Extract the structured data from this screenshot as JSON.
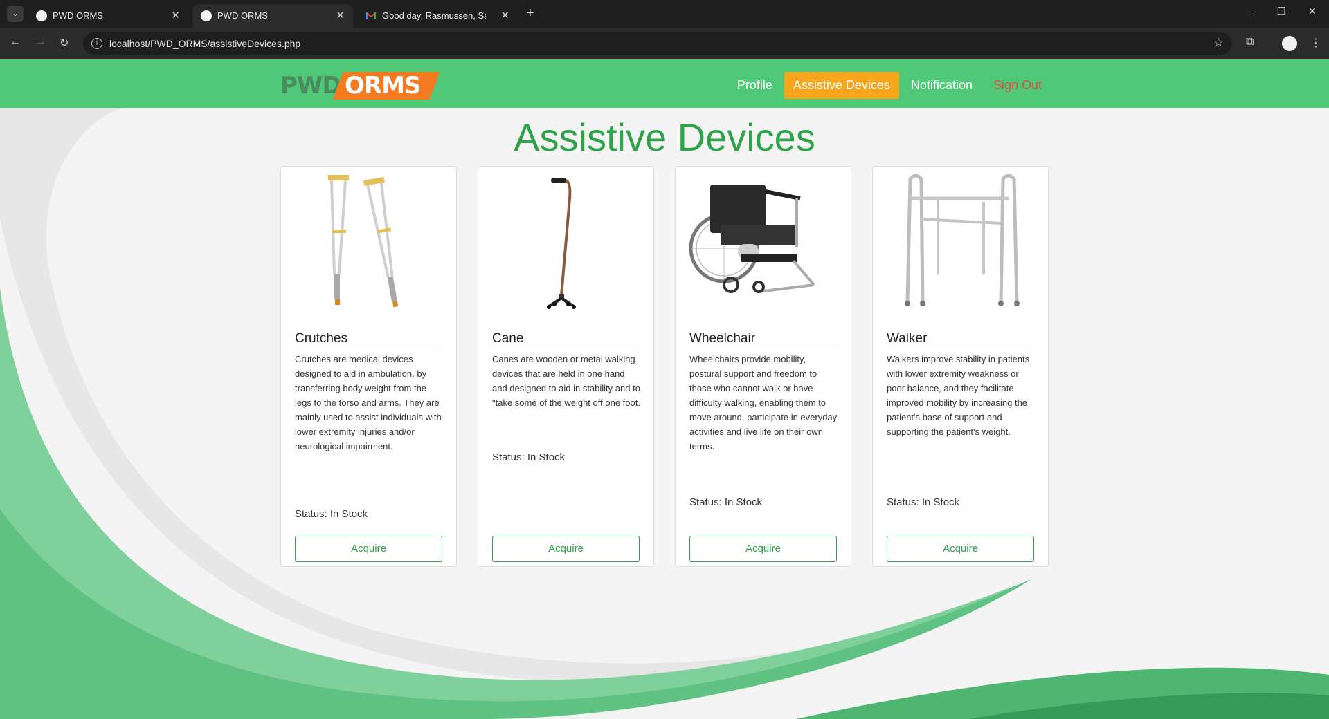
{
  "browser": {
    "tabs": [
      {
        "title": "PWD ORMS",
        "active": false
      },
      {
        "title": "PWD ORMS",
        "active": true
      },
      {
        "title": "Good day, Rasmussen, Sara Au",
        "active": false
      }
    ],
    "url": "localhost/PWD_ORMS/assistiveDevices.php"
  },
  "nav": {
    "logo_pwd": "PWD",
    "logo_orms": "ORMS",
    "links": [
      "Profile",
      "Assistive Devices",
      "Notification",
      "Sign Out"
    ]
  },
  "page": {
    "title": "Assistive Devices"
  },
  "devices": [
    {
      "name": "Crutches",
      "description": "Crutches are medical devices designed to aid in ambulation, by transferring body weight from the legs to the torso and arms. They are mainly used to assist individuals with lower extremity injuries and/or neurological impairment.",
      "status": "Status: In Stock",
      "button": "Acquire",
      "image_icon": "crutches-image"
    },
    {
      "name": "Cane",
      "description": "Canes are wooden or metal walking devices that are held in one hand and designed to aid in stability and to \"take some of the weight off one foot.",
      "status": "Status: In Stock",
      "button": "Acquire",
      "image_icon": "cane-image"
    },
    {
      "name": "Wheelchair",
      "description": "Wheelchairs provide mobility, postural support and freedom to those who cannot walk or have difficulty walking, enabling them to move around, participate in everyday activities and live life on their own terms.",
      "status": "Status: In Stock",
      "button": "Acquire",
      "image_icon": "wheelchair-image"
    },
    {
      "name": "Walker",
      "description": "Walkers improve stability in patients with lower extremity weakness or poor balance, and they facilitate improved mobility by increasing the patient's base of support and supporting the patient's weight.",
      "status": "Status: In Stock",
      "button": "Acquire",
      "image_icon": "walker-image"
    }
  ],
  "colors": {
    "navbar": "#4fc977",
    "accent_green": "#2ea349",
    "active_nav": "#f7a61c",
    "signout": "#d9533e",
    "logo_orange": "#f47b20"
  }
}
